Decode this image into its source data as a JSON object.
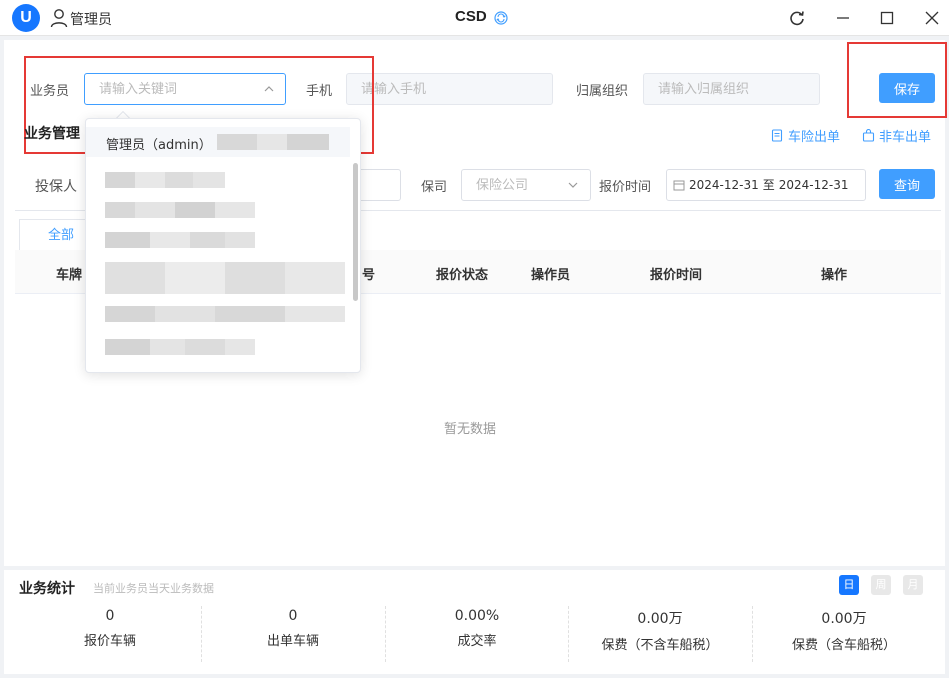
{
  "titlebar": {
    "logo_text": "U",
    "user_name": "管理员",
    "app_title": "CSD"
  },
  "filters": {
    "salesman_label": "业务员",
    "salesman_placeholder": "请输入关键词",
    "phone_label": "手机",
    "phone_placeholder": "请输入手机",
    "org_label": "归属组织",
    "org_placeholder": "请输入归属组织",
    "save_label": "保存"
  },
  "section": {
    "title": "业务管理",
    "car_insurance_link": "车险出单",
    "non_car_link": "非车出单"
  },
  "search": {
    "insured_label": "投保人",
    "insurer_label": "保司",
    "insurer_placeholder": "保险公司",
    "quote_time_label": "报价时间",
    "date_start": "2024-12-31",
    "date_sep": "至",
    "date_end": "2024-12-31",
    "query_label": "查询"
  },
  "tabs": [
    {
      "label": "全部"
    }
  ],
  "table": {
    "columns": [
      "车牌",
      "号",
      "报价状态",
      "操作员",
      "报价时间",
      "操作"
    ],
    "empty_text": "暂无数据"
  },
  "dropdown": {
    "items": [
      {
        "label": "管理员（admin）"
      }
    ]
  },
  "stats": {
    "title": "业务统计",
    "subtitle": "当前业务员当天业务数据",
    "periods": [
      "日",
      "周",
      "月"
    ],
    "items": [
      {
        "value": "0",
        "label": "报价车辆"
      },
      {
        "value": "0",
        "label": "出单车辆"
      },
      {
        "value": "0.00%",
        "label": "成交率"
      },
      {
        "value": "0.00万",
        "label": "保费（不含车船税）"
      },
      {
        "value": "0.00万",
        "label": "保费（含车船税）"
      }
    ]
  },
  "colors": {
    "primary": "#409eff",
    "highlight": "#e53935"
  }
}
